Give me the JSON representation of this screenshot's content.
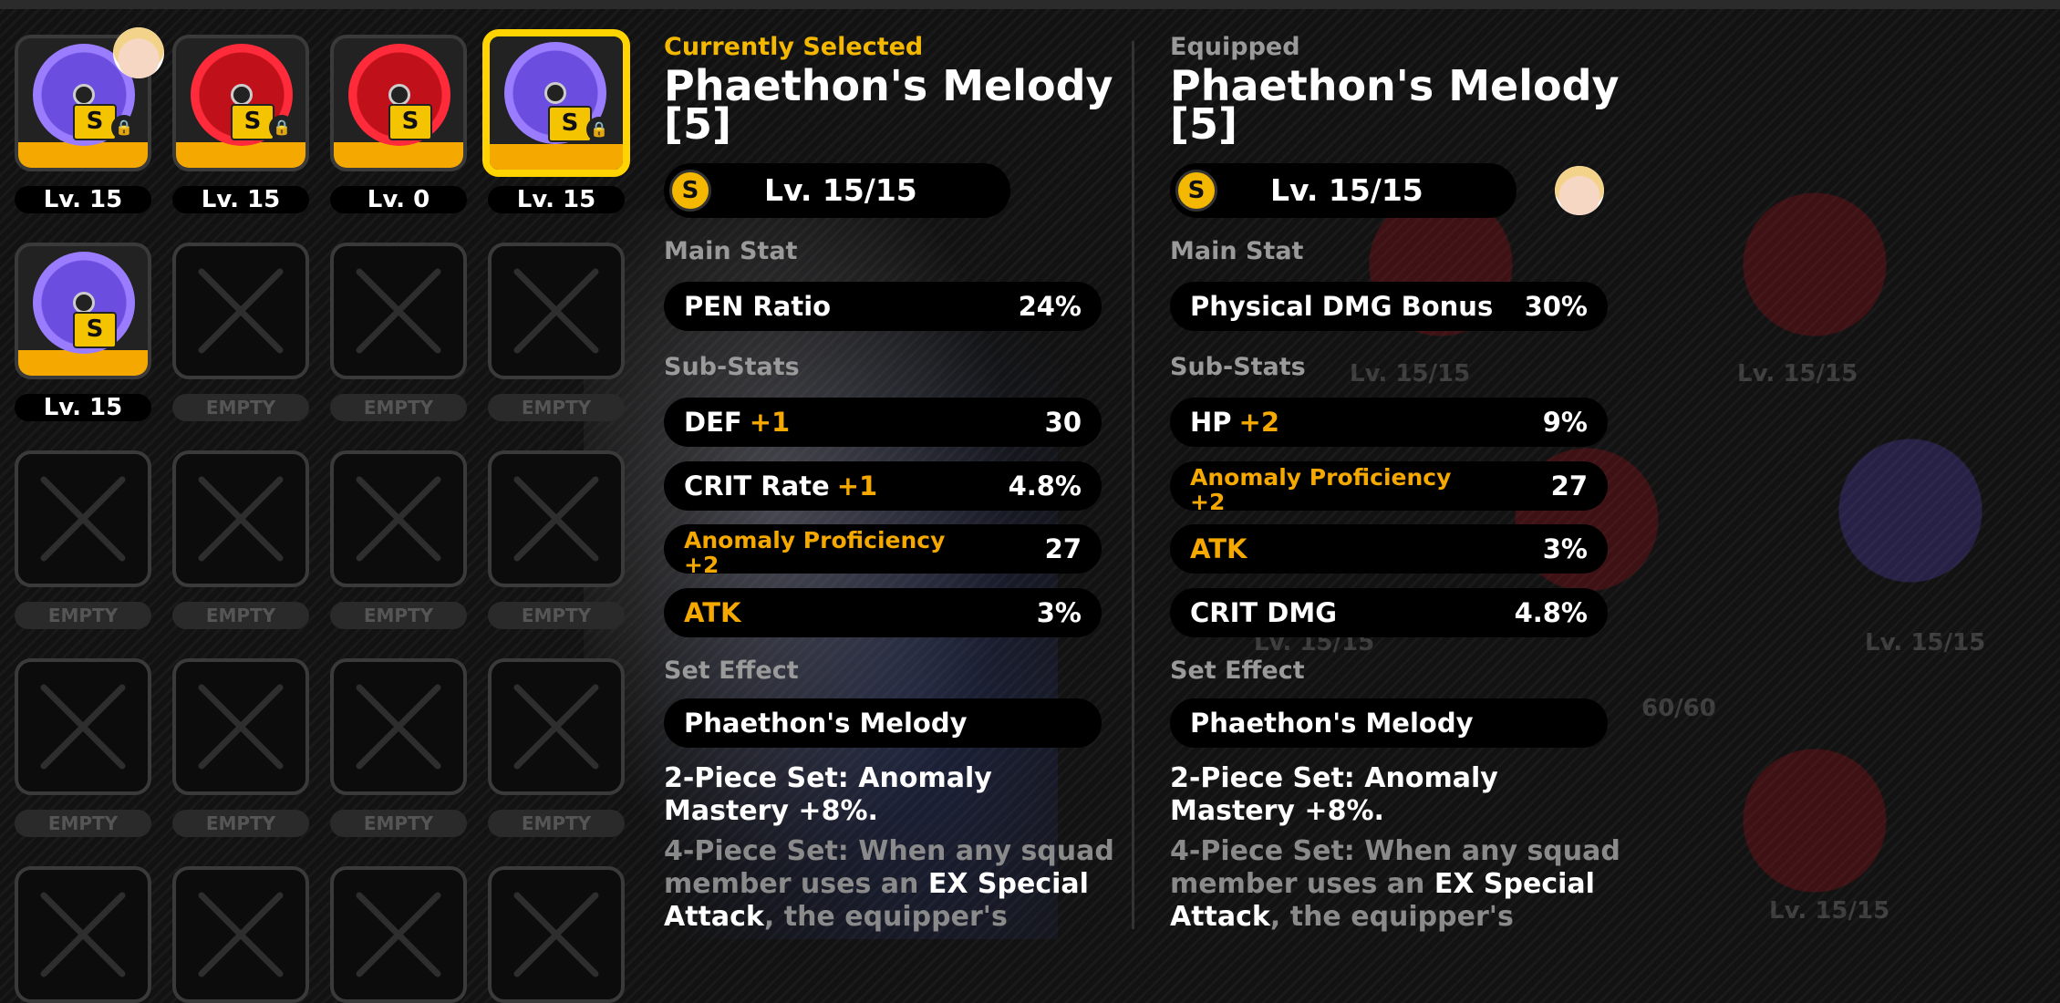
{
  "grid": {
    "rows": [
      [
        {
          "state": "filled",
          "disc": "purple",
          "level": "Lv. 15",
          "locked": true,
          "selected": false
        },
        {
          "state": "filled",
          "disc": "red",
          "level": "Lv. 15",
          "locked": true,
          "selected": false
        },
        {
          "state": "filled",
          "disc": "red",
          "level": "Lv. 0",
          "locked": false,
          "selected": false
        },
        {
          "state": "filled",
          "disc": "purple",
          "level": "Lv. 15",
          "locked": true,
          "selected": true
        }
      ],
      [
        {
          "state": "filled",
          "disc": "purple",
          "level": "Lv. 15",
          "locked": false,
          "selected": false
        },
        {
          "state": "empty",
          "level": "EMPTY"
        },
        {
          "state": "empty",
          "level": "EMPTY"
        },
        {
          "state": "empty",
          "level": "EMPTY"
        }
      ],
      [
        {
          "state": "empty",
          "level": "EMPTY"
        },
        {
          "state": "empty",
          "level": "EMPTY"
        },
        {
          "state": "empty",
          "level": "EMPTY"
        },
        {
          "state": "empty",
          "level": "EMPTY"
        }
      ],
      [
        {
          "state": "empty",
          "level": "EMPTY"
        },
        {
          "state": "empty",
          "level": "EMPTY"
        },
        {
          "state": "empty",
          "level": "EMPTY"
        },
        {
          "state": "empty",
          "level": "EMPTY"
        }
      ],
      [
        {
          "state": "empty",
          "level": ""
        },
        {
          "state": "empty",
          "level": ""
        },
        {
          "state": "empty",
          "level": ""
        },
        {
          "state": "empty",
          "level": ""
        }
      ]
    ],
    "rank_badge": "S",
    "lock_glyph": "🔒"
  },
  "selected": {
    "header": "Currently Selected",
    "title_line1": "Phaethon's Melody",
    "title_line2": "[5]",
    "level": "Lv. 15/15",
    "rank": "S",
    "main_stat_label": "Main Stat",
    "main_stat": {
      "name": "PEN Ratio",
      "value": "24%"
    },
    "sub_stats_label": "Sub-Stats",
    "sub_stats": [
      {
        "name": "DEF",
        "plus": "+1",
        "value": "30"
      },
      {
        "name": "CRIT Rate",
        "plus": "+1",
        "value": "4.8%"
      },
      {
        "name": "Anomaly Proficiency",
        "plus": "+2",
        "value": "27"
      },
      {
        "name": "ATK",
        "plus": "",
        "value": "3%"
      }
    ],
    "set_effect_label": "Set Effect",
    "set_name": "Phaethon's Melody",
    "two_piece": "2-Piece Set: Anomaly Mastery +8%.",
    "four_piece_a": "4-Piece Set: When any squad member uses an ",
    "four_piece_b": "EX Special Attack",
    "four_piece_c": ", the equipper's"
  },
  "equipped": {
    "header": "Equipped",
    "title_line1": "Phaethon's Melody",
    "title_line2": "[5]",
    "level": "Lv. 15/15",
    "rank": "S",
    "main_stat_label": "Main Stat",
    "main_stat": {
      "name": "Physical DMG Bonus",
      "value": "30%"
    },
    "sub_stats_label": "Sub-Stats",
    "sub_stats": [
      {
        "name": "HP",
        "plus": "+2",
        "value": "9%"
      },
      {
        "name": "Anomaly Proficiency",
        "plus": "+2",
        "value": "27"
      },
      {
        "name": "ATK",
        "plus": "",
        "value": "3%"
      },
      {
        "name": "CRIT DMG",
        "plus": "",
        "value": "4.8%"
      }
    ],
    "set_effect_label": "Set Effect",
    "set_name": "Phaethon's Melody",
    "two_piece": "2-Piece Set: Anomaly Mastery +8%.",
    "four_piece_a": "4-Piece Set: When any squad member uses an ",
    "four_piece_b": "EX Special Attack",
    "four_piece_c": ", the equipper's"
  },
  "background_ghost_labels": [
    "Lv. 15/15",
    "Lv. 15/15",
    "Lv. 15/15",
    "Lv. 15/15",
    "60/60",
    "Lv. 15/15"
  ],
  "colors": {
    "accent": "#f5a800",
    "selected_border": "#ffd400",
    "muted": "#9a9a9a"
  }
}
